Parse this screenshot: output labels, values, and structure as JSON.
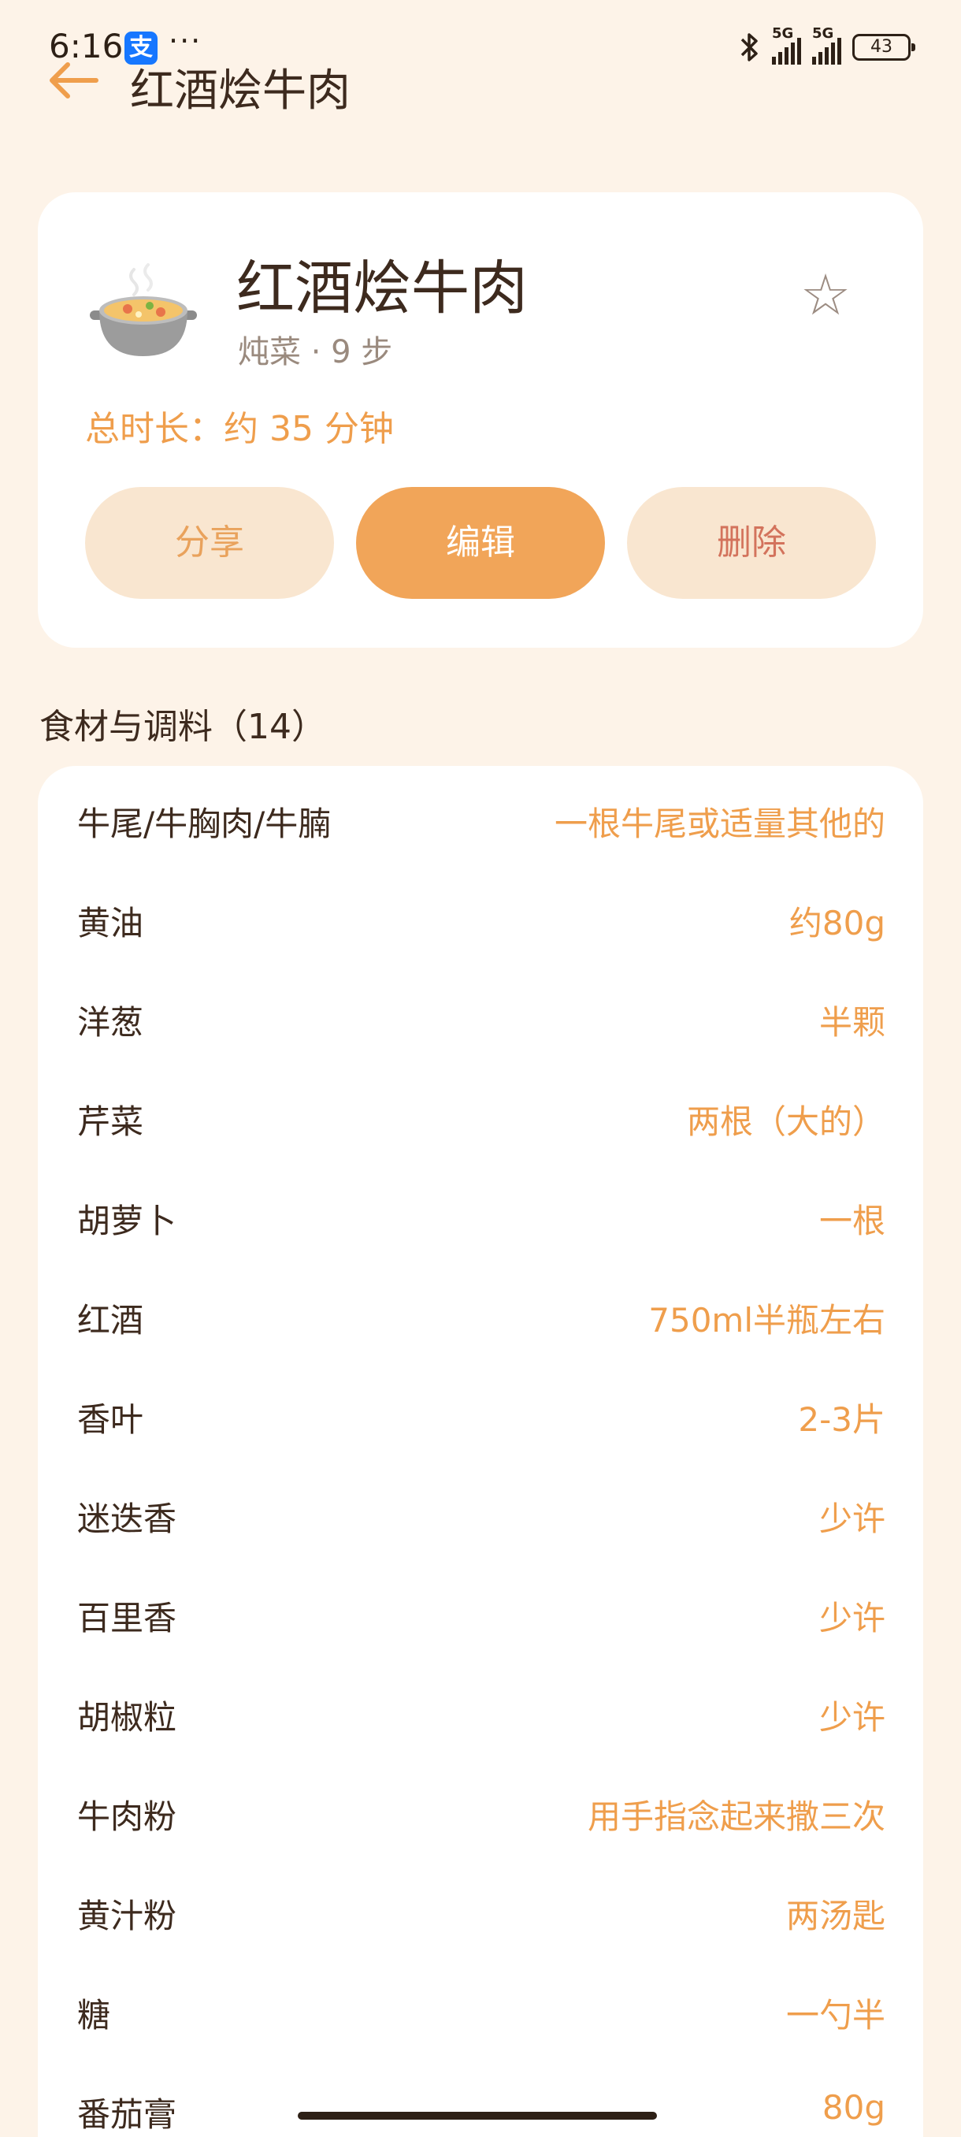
{
  "status_bar": {
    "time": "6:16",
    "alipay_glyph": "支",
    "more": "···",
    "network_1": "5G",
    "network_2": "5G",
    "battery": "43"
  },
  "header": {
    "title": "红酒烩牛肉"
  },
  "recipe": {
    "icon": "cooking-pot-icon",
    "name": "红酒烩牛肉",
    "meta": "炖菜 · 9 步",
    "total_time": "总时长：约 35 分钟",
    "favorite_glyph": "☆"
  },
  "actions": {
    "share": "分享",
    "edit": "编辑",
    "delete": "删除"
  },
  "ingredients": {
    "title": "食材与调料（14）",
    "items": [
      {
        "name": "牛尾/牛胸肉/牛腩",
        "amount": "一根牛尾或适量其他的"
      },
      {
        "name": "黄油",
        "amount": "约80g"
      },
      {
        "name": "洋葱",
        "amount": "半颗"
      },
      {
        "name": "芹菜",
        "amount": "两根（大的）"
      },
      {
        "name": "胡萝卜",
        "amount": "一根"
      },
      {
        "name": "红酒",
        "amount": "750ml半瓶左右"
      },
      {
        "name": "香叶",
        "amount": "2-3片"
      },
      {
        "name": "迷迭香",
        "amount": "少许"
      },
      {
        "name": "百里香",
        "amount": "少许"
      },
      {
        "name": "胡椒粒",
        "amount": "少许"
      },
      {
        "name": "牛肉粉",
        "amount": "用手指念起来撒三次"
      },
      {
        "name": "黄汁粉",
        "amount": "两汤匙"
      },
      {
        "name": "糖",
        "amount": "一勺半"
      },
      {
        "name": "番茄膏",
        "amount": "80g"
      }
    ]
  },
  "colors": {
    "background": "#fdf3e8",
    "accent": "#f1a559",
    "accent_text": "#ef9e4c",
    "delete_text": "#d3735c"
  }
}
